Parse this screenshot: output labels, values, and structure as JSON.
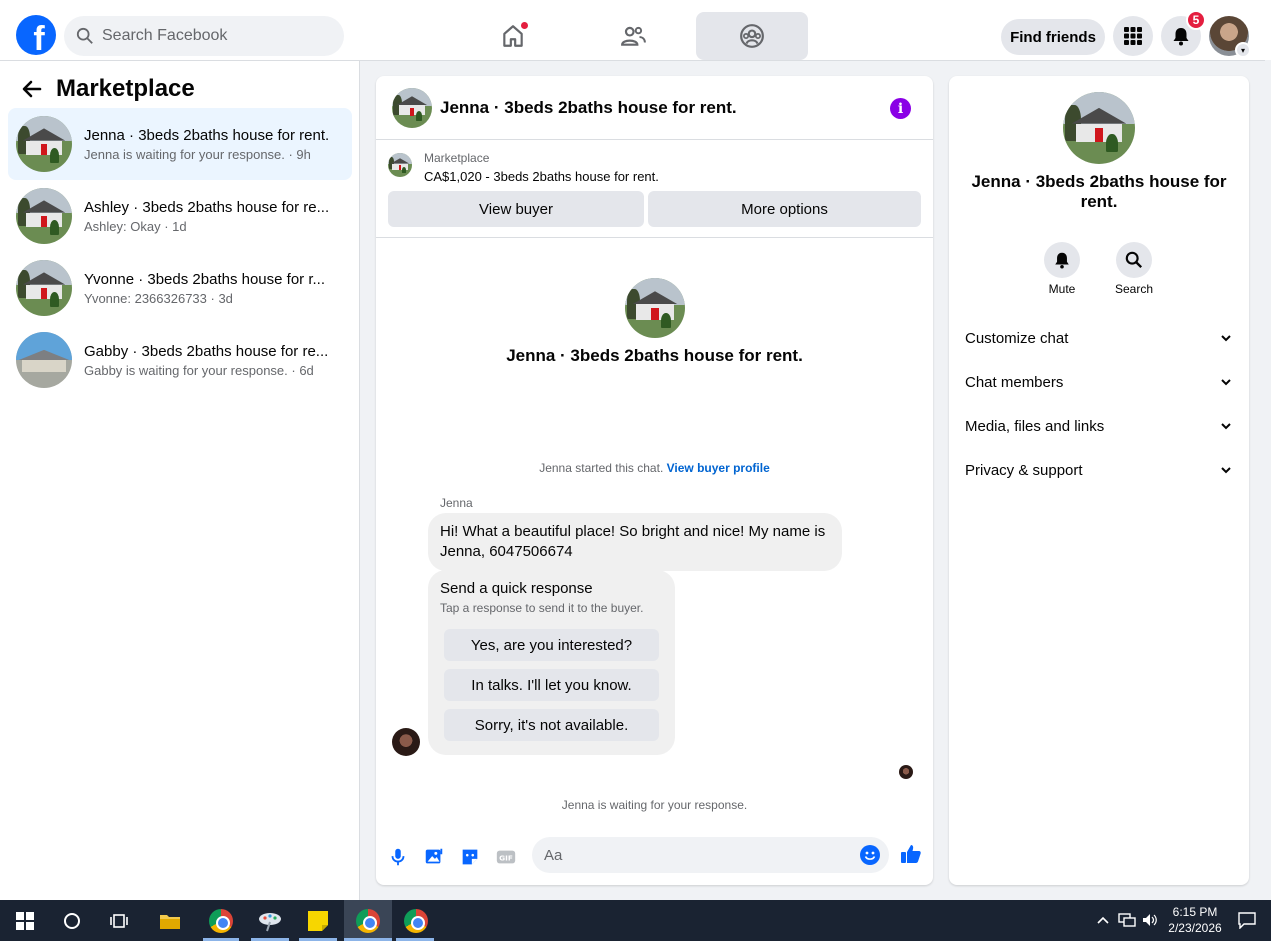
{
  "topbar": {
    "logo_letter": "f",
    "search_placeholder": "Search Facebook",
    "find_friends": "Find friends",
    "notifications_count": "5"
  },
  "sidebar": {
    "title": "Marketplace",
    "conversations": [
      {
        "title": "Jenna · 3beds 2baths house for rent.",
        "sub": "Jenna is waiting for your response. · 9h",
        "active": true
      },
      {
        "title": "Ashley · 3beds 2baths house for re...",
        "sub": "Ashley: Okay · 1d",
        "active": false
      },
      {
        "title": "Yvonne · 3beds 2baths house for r...",
        "sub": "Yvonne: 2366326733 · 3d",
        "active": false
      },
      {
        "title": "Gabby · 3beds 2baths house for re...",
        "sub": "Gabby is waiting for your response. · 6d",
        "active": false
      }
    ]
  },
  "chat": {
    "header_title": "Jenna · 3beds 2baths house for rent.",
    "marketplace_label": "Marketplace",
    "listing_price": "CA$1,020 - 3beds 2baths house for rent.",
    "view_buyer": "View buyer",
    "more_options": "More options",
    "intro_title": "Jenna · 3beds 2baths house for rent.",
    "started_text": "Jenna started this chat.",
    "view_buyer_profile": "View buyer profile",
    "sender_name": "Jenna",
    "message": "Hi! What a beautiful place! So bright and nice! My name is Jenna, 6047506674",
    "quick_response_title": "Send a quick response",
    "quick_response_sub": "Tap a response to send it to the buyer.",
    "quick_responses": [
      "Yes, are you interested?",
      "In talks. I'll let you know.",
      "Sorry, it's not available."
    ],
    "waiting_text": "Jenna is waiting for your response.",
    "input_placeholder": "Aa"
  },
  "details": {
    "title": "Jenna · 3beds 2baths house for rent.",
    "mute": "Mute",
    "search": "Search",
    "sections": [
      "Customize chat",
      "Chat members",
      "Media, files and links",
      "Privacy & support"
    ]
  },
  "taskbar": {
    "time": "6:15 PM",
    "date": "2/23/2026"
  },
  "colors": {
    "brand_blue": "#0866ff",
    "active_conv_bg": "#ebf5ff",
    "notification_red": "#e41e3f",
    "info_purple": "#8a00e6",
    "link_blue": "#0064d1"
  }
}
